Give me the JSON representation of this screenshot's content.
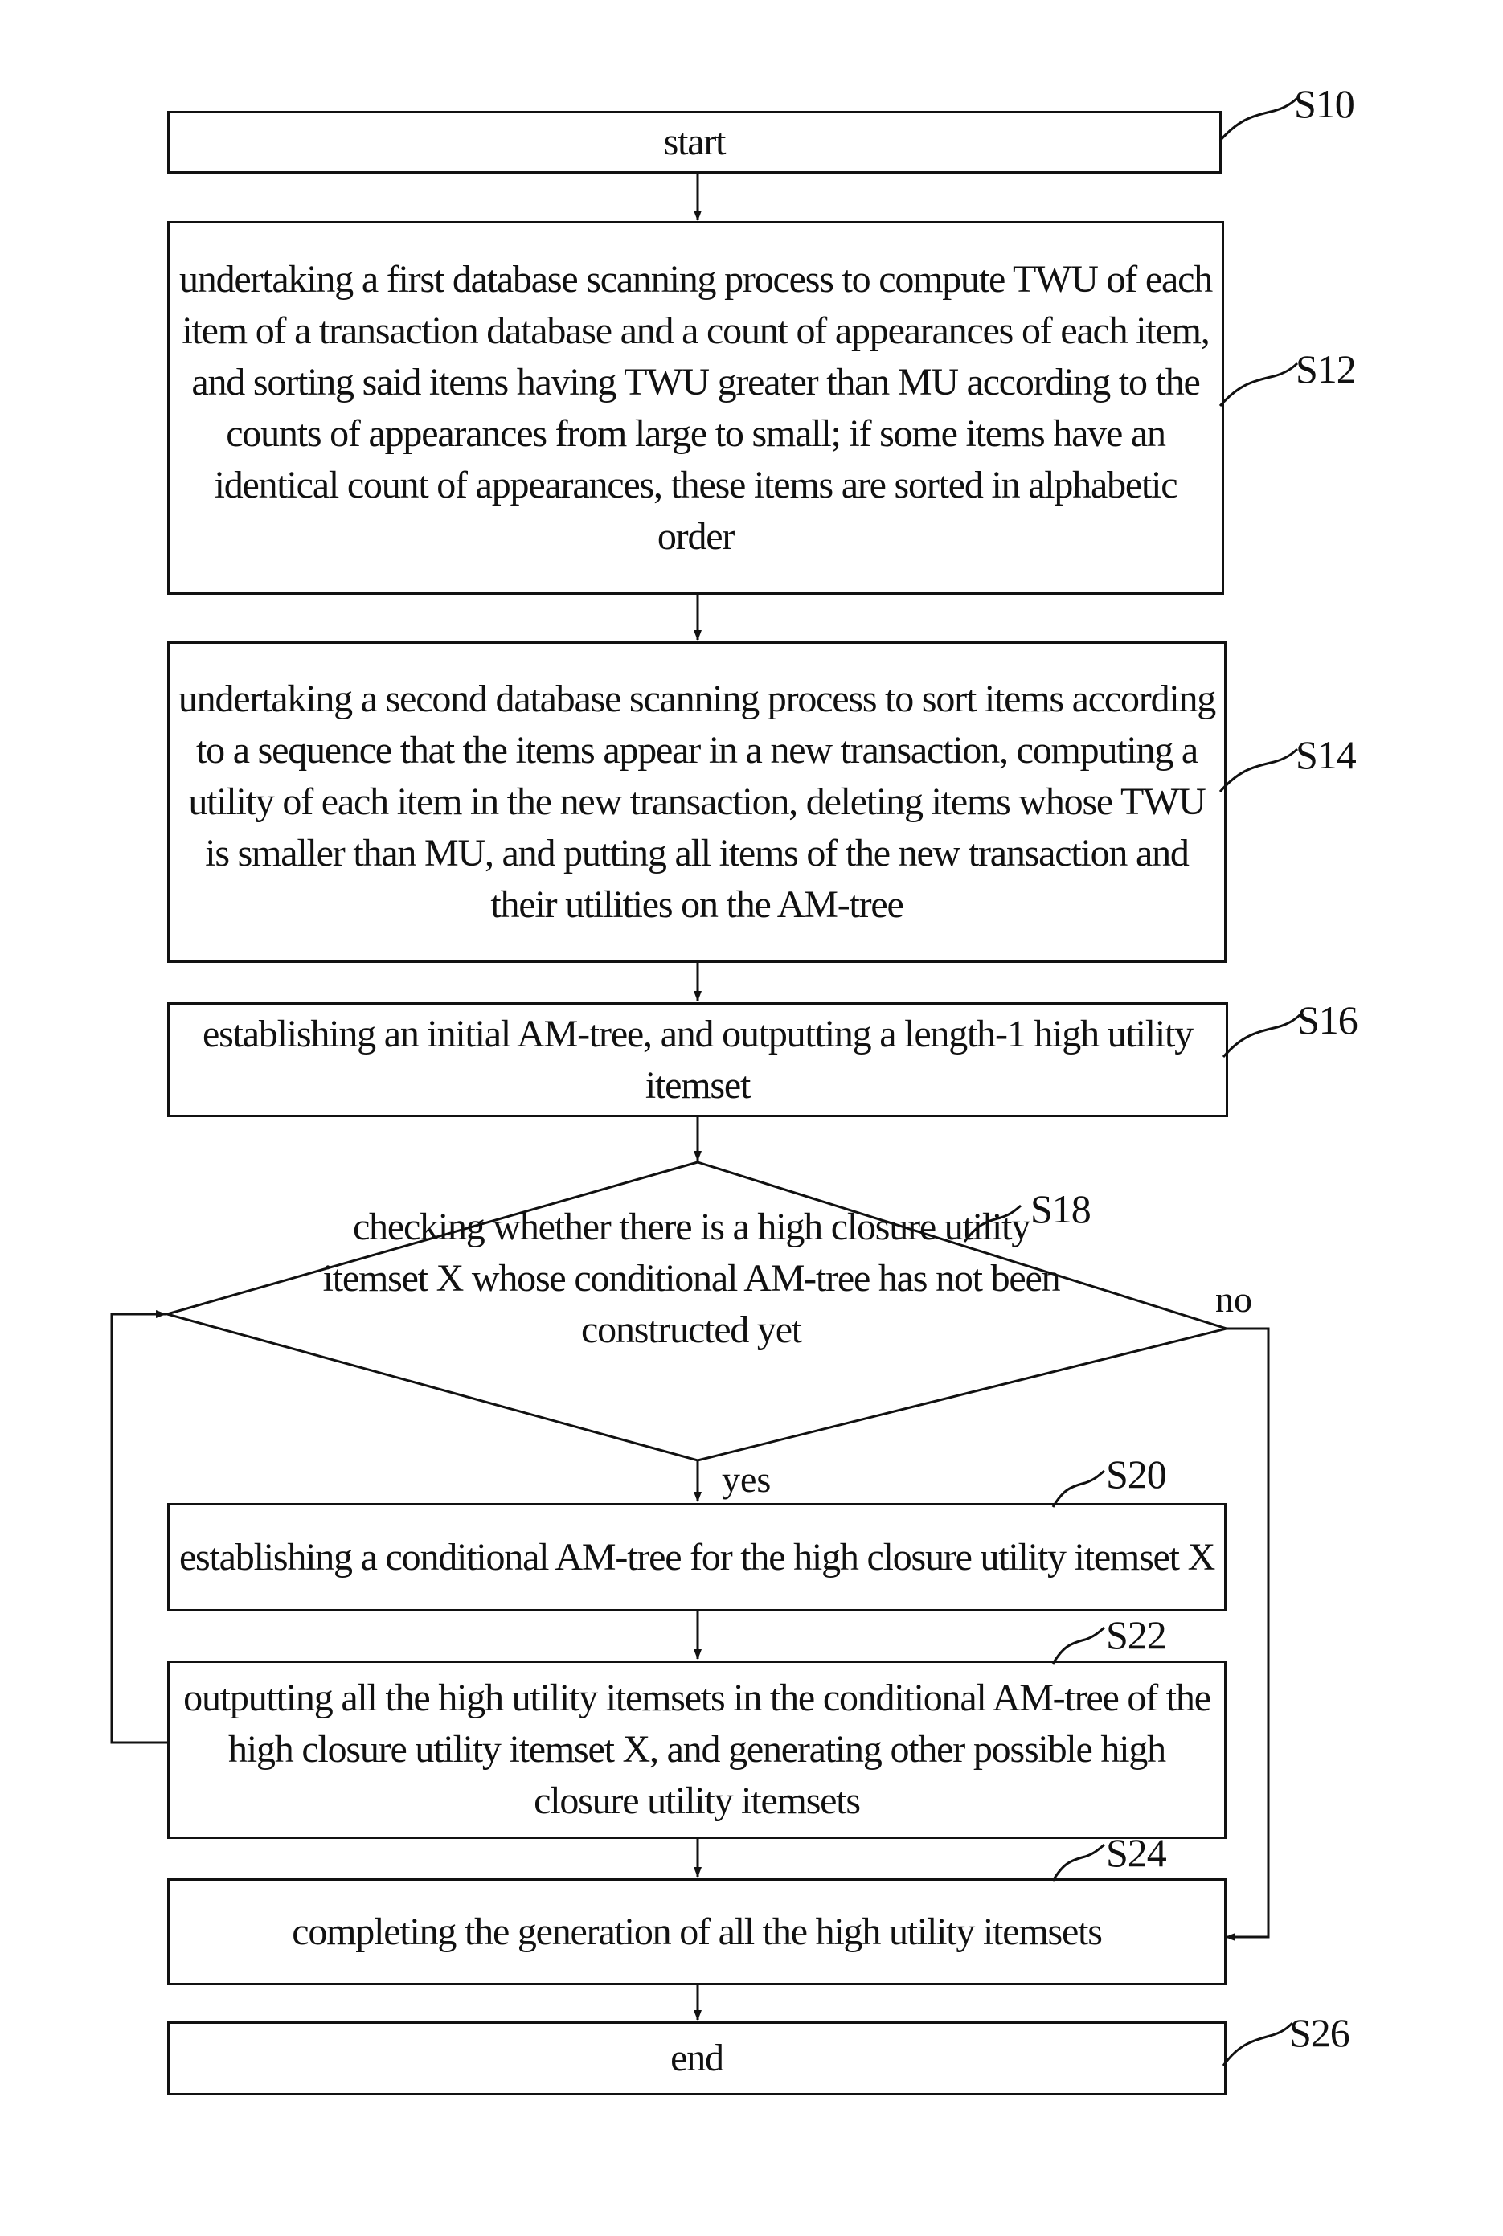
{
  "flowchart": {
    "steps": [
      {
        "id": "S10",
        "text": "start"
      },
      {
        "id": "S12",
        "text": "undertaking a first database scanning process to compute TWU of each item of a transaction database and a count of appearances of each item, and sorting said items having TWU greater than MU according to the counts of appearances from large to small; if some items have an identical count of appearances, these items are sorted in alphabetic order"
      },
      {
        "id": "S14",
        "text": "undertaking a second database scanning process to sort items according to a sequence that the items appear in a new transaction, computing a utility of each item in the new transaction, deleting items whose TWU is smaller than MU, and putting all items of the new transaction and their utilities on the AM-tree"
      },
      {
        "id": "S16",
        "text": "establishing an initial AM-tree, and outputting a length-1 high utility itemset"
      },
      {
        "id": "S18",
        "text": "checking whether there is a high closure utility itemset X whose conditional AM-tree has not been constructed yet"
      },
      {
        "id": "S20",
        "text": "establishing a conditional AM-tree for the high closure utility itemset X"
      },
      {
        "id": "S22",
        "text": "outputting all the high utility itemsets in the conditional AM-tree of the high closure utility itemset X, and generating other possible high closure utility itemsets"
      },
      {
        "id": "S24",
        "text": "completing the generation of all the high utility itemsets"
      },
      {
        "id": "S26",
        "text": "end"
      }
    ],
    "branch_labels": {
      "yes": "yes",
      "no": "no"
    },
    "edges": [
      {
        "from": "S10",
        "to": "S12"
      },
      {
        "from": "S12",
        "to": "S14"
      },
      {
        "from": "S14",
        "to": "S16"
      },
      {
        "from": "S16",
        "to": "S18"
      },
      {
        "from": "S18",
        "to": "S20",
        "label": "yes"
      },
      {
        "from": "S18",
        "to": "S24",
        "label": "no"
      },
      {
        "from": "S20",
        "to": "S22"
      },
      {
        "from": "S22",
        "to": "S18"
      },
      {
        "from": "S24",
        "to": "S26"
      }
    ]
  }
}
